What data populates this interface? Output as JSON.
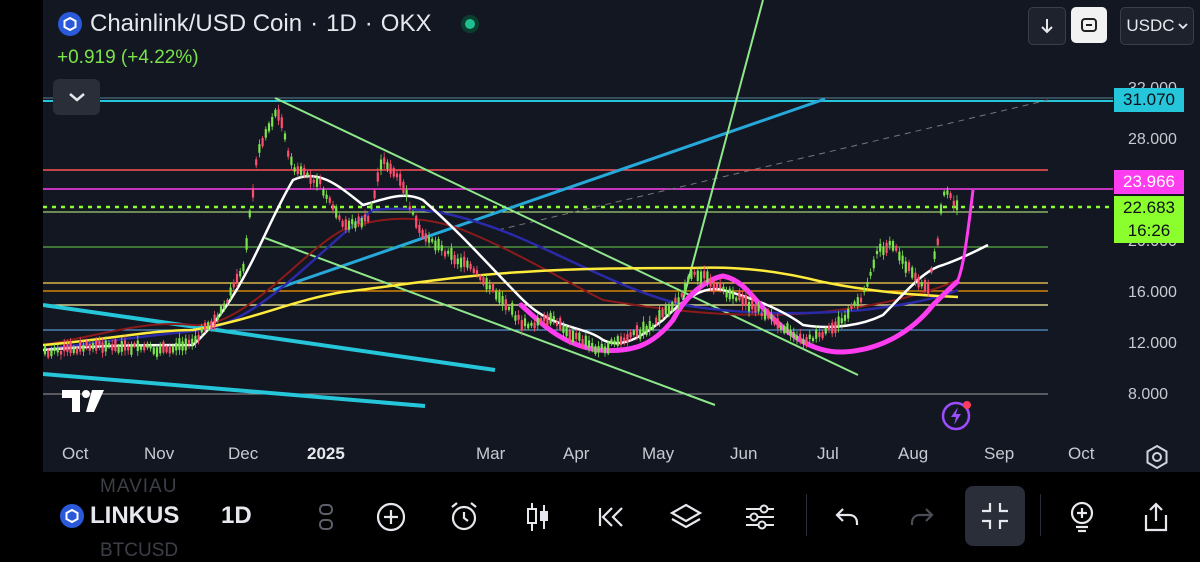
{
  "header": {
    "pair": "Chainlink/USD Coin",
    "interval": "1D",
    "exchange": "OKX",
    "separator": "·",
    "change": "+0.919 (+4.22%)",
    "currency": "USDC"
  },
  "price_axis": {
    "ticks": [
      "32.000",
      "28.000",
      "20.000",
      "16.000",
      "12.000",
      "8.000"
    ],
    "labels": {
      "resistance": "31.070",
      "pink_level": "23.966",
      "last_price": "22.683",
      "countdown": "16:26"
    }
  },
  "time_axis": [
    "Oct",
    "Nov",
    "Dec",
    "2025",
    "Mar",
    "Apr",
    "May",
    "Jun",
    "Jul",
    "Aug",
    "Sep",
    "Oct"
  ],
  "toolbar": {
    "symbol": "LINKUSDC",
    "symbol_shown": "LINKUS",
    "interval": "1D",
    "behind_top": "MAVIAU",
    "behind_bottom": "BTCUSD"
  },
  "colors": {
    "accent_green": "#7be34b",
    "resistance": "#26c6da",
    "pink": "#ff3df0",
    "last_price": "#8bff2e"
  },
  "icons": [
    "download-icon",
    "fit-icon",
    "chevron-down-icon",
    "tradingview-logo",
    "alert-icon",
    "settings-icon",
    "add-icon",
    "alarm-icon",
    "candles-icon",
    "replay-icon",
    "layers-icon",
    "indicators-icon",
    "undo-icon",
    "redo-icon",
    "fullscreen-exit-icon",
    "add-indicator-icon",
    "share-icon"
  ]
}
